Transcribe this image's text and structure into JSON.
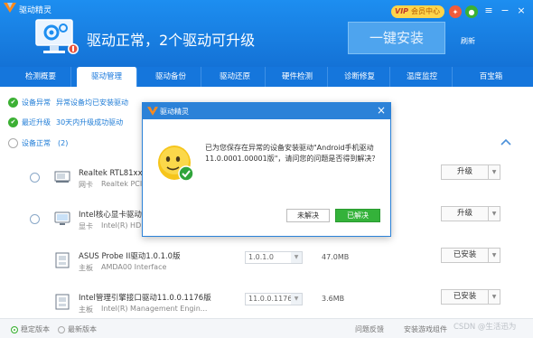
{
  "app": {
    "title": "驱动精灵",
    "member": "会员中心",
    "vip_tag": "VIP"
  },
  "header": {
    "headline": "驱动正常，2个驱动可升级",
    "one_key": "一键安装",
    "refresh": "刷新"
  },
  "tabs": [
    "检测概要",
    "驱动管理",
    "驱动备份",
    "驱动还原",
    "硬件检测",
    "诊断修复",
    "温度监控",
    "百宝箱"
  ],
  "status": {
    "abnormal": {
      "label": "设备异常",
      "text": "异常设备均已安装驱动"
    },
    "upgrade": {
      "label": "最近升级",
      "text": "30天内升级成功驱动"
    },
    "normal": {
      "label": "设备正常",
      "count": "(2)"
    }
  },
  "rows": [
    {
      "name": "Realtek RTL81xx系",
      "type": "网卡",
      "sub": "Realtek PCIe",
      "version": "",
      "size": "",
      "action": "升级"
    },
    {
      "name": "Intel核心显卡驱动20",
      "type": "显卡",
      "sub": "Intel(R) HD G",
      "version": "",
      "size": "",
      "action": "升级"
    },
    {
      "name": "ASUS Probe II驱动1.0.1.0版",
      "type": "主板",
      "sub": "AMDA00 Interface",
      "version": "1.0.1.0",
      "size": "47.0MB",
      "action": "已安装"
    },
    {
      "name": "Intel管理引擎接口驱动11.0.0.1176版",
      "type": "主板",
      "sub": "Intel(R) Management Engin...",
      "version": "11.0.0.1176",
      "size": "3.6MB",
      "action": "已安装"
    }
  ],
  "footer": {
    "stable": "稳定版本",
    "latest": "最新版本",
    "feedback": "问题反馈",
    "game": "安装游戏组件",
    "watermark": "CSDN @生活迅为"
  },
  "dialog": {
    "title": "驱动精灵",
    "message": "已为您保存在异常的设备安装驱动\"Android手机驱动11.0.0001.00001版\"，请问您的问题是否得到解决？",
    "btn_no": "未解决",
    "btn_yes": "已解决"
  },
  "colors": {
    "brand": "#1576dc",
    "success": "#34b23a"
  }
}
